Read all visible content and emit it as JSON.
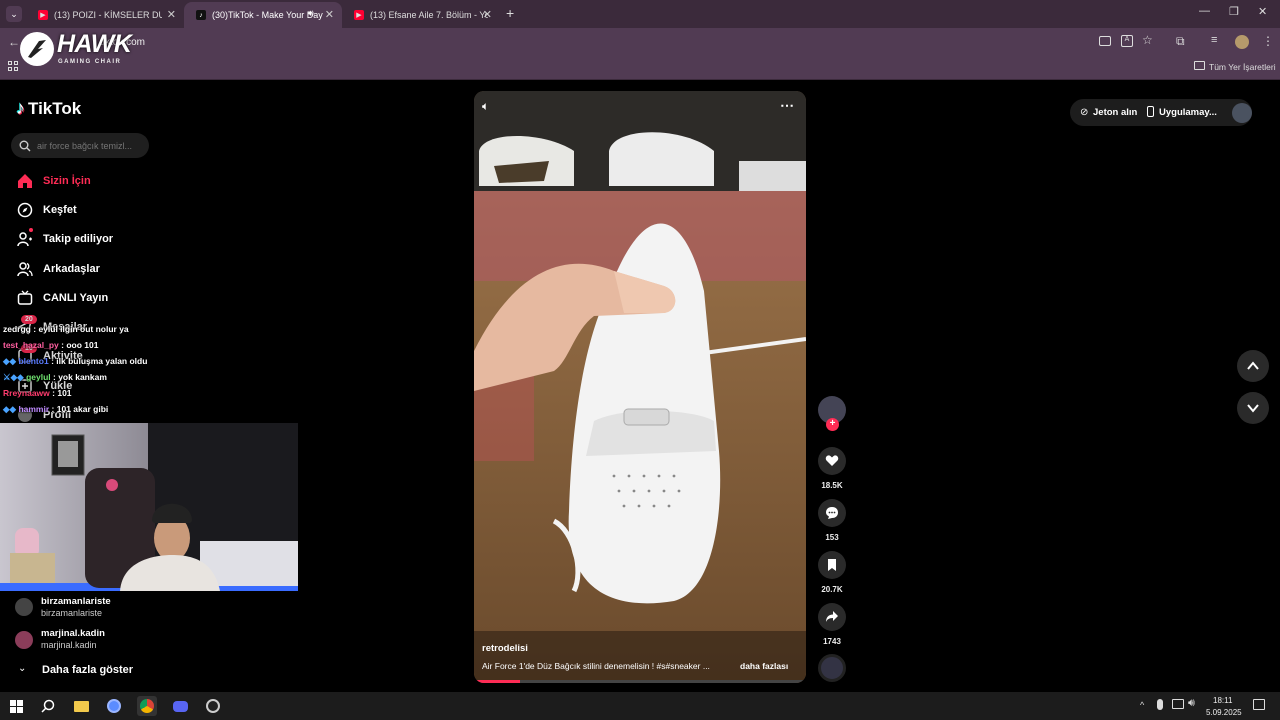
{
  "browser": {
    "tabs": [
      {
        "title": "(13) POIZI - KİMSELER DUYMASIN",
        "icon": "youtube-icon"
      },
      {
        "title": "(30)TikTok - Make Your Day",
        "icon": "tiktok-icon"
      },
      {
        "title": "(13) Efsane Aile 7. Bölüm - YouTube",
        "icon": "youtube-icon"
      }
    ],
    "url": "tiktok.com",
    "bookmarks_label": "Tüm Yer İşaretleri"
  },
  "overlay": {
    "logo_text": "HAWK",
    "logo_sub": "GAMING CHAIR"
  },
  "tiktok": {
    "logo": "TikTok",
    "search_placeholder": "air force bağcık temizl...",
    "nav": [
      {
        "label": "Sizin İçin",
        "icon": "home-icon",
        "active": true
      },
      {
        "label": "Keşfet",
        "icon": "compass-icon"
      },
      {
        "label": "Takip ediliyor",
        "icon": "following-icon"
      },
      {
        "label": "Arkadaşlar",
        "icon": "friends-icon"
      },
      {
        "label": "CANLI Yayın",
        "icon": "live-icon"
      },
      {
        "label": "Mesajlar",
        "icon": "message-icon",
        "badge": "20"
      },
      {
        "label": "Aktivite",
        "icon": "activity-icon",
        "badge": "10"
      },
      {
        "label": "Yükle",
        "icon": "upload-icon"
      },
      {
        "label": "Profil",
        "icon": "profile-icon"
      }
    ],
    "following": [
      {
        "handle": "birzamanlariste",
        "name": "birzamanlariste"
      },
      {
        "handle": "marjinal.kadin",
        "name": "marjinal.kadin"
      }
    ],
    "show_more": "Daha fazla göster",
    "top_right": {
      "coins": "Jeton alın",
      "app": "Uygulamay..."
    },
    "video": {
      "author": "retrodelisi",
      "caption": "Air Force 1'de Düz Bağcık stilini denemelisin ! #s#sneaker ...",
      "more": "daha fazlası",
      "likes": "18.5K",
      "comments": "153",
      "saves": "20.7K",
      "shares": "1743"
    }
  },
  "chat": [
    {
      "user": "zedrgg",
      "msg": ": eylül ilgin out nolur ya",
      "color": "#ffffff"
    },
    {
      "user": "test_hazal_py",
      "msg": ": ooo 101",
      "color": "#ff5fa0"
    },
    {
      "user": "blento1",
      "msg": ": ilk buluşma yalan oldu",
      "color": "#5b7cff"
    },
    {
      "user": "geylul",
      "msg": ": yok kankam",
      "color": "#6fe36f"
    },
    {
      "user": "Rreynaaww",
      "msg": ": 101",
      "color": "#ff3c6e"
    },
    {
      "user": "hammir",
      "msg": ": 101 akar gibi",
      "color": "#c08bff"
    }
  ],
  "taskbar": {
    "time": "18:11",
    "date": "5.09.2025"
  }
}
